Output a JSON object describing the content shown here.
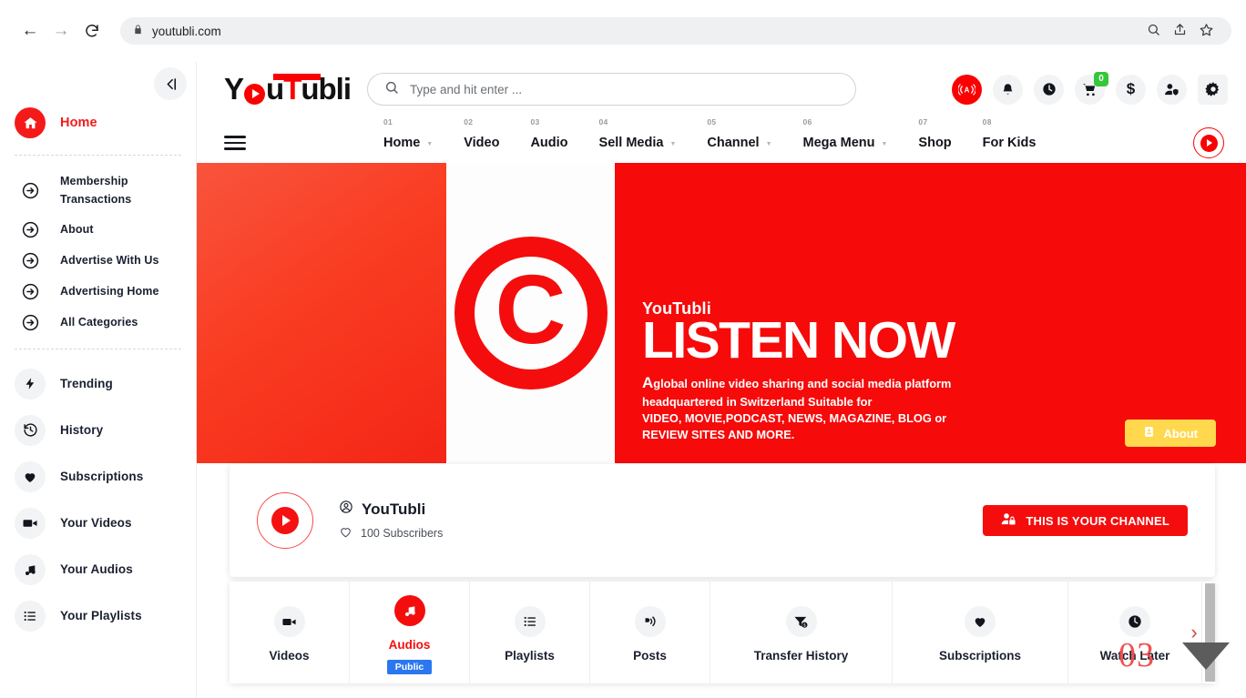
{
  "browser": {
    "back_icon": "back-arrow-icon",
    "forward_icon": "forward-arrow-icon",
    "reload_icon": "reload-icon",
    "lock_icon": "lock-icon",
    "url": "youtubli.com",
    "zoom_icon": "search-zoom-icon",
    "share_icon": "share-icon",
    "bookmark_icon": "star-icon"
  },
  "sidebar": {
    "collapse_label": "collapse-sidebar",
    "home": {
      "label": "Home",
      "icon": "home-icon"
    },
    "links": [
      {
        "label": "Membership Transactions",
        "icon": "arrow-circle-icon"
      },
      {
        "label": "About",
        "icon": "arrow-circle-icon"
      },
      {
        "label": "Advertise With Us",
        "icon": "arrow-circle-icon"
      },
      {
        "label": "Advertising Home",
        "icon": "arrow-circle-icon"
      },
      {
        "label": "All Categories",
        "icon": "arrow-circle-icon"
      }
    ],
    "items": [
      {
        "label": "Trending",
        "icon": "bolt-icon"
      },
      {
        "label": "History",
        "icon": "history-icon"
      },
      {
        "label": "Subscriptions",
        "icon": "heart-icon"
      },
      {
        "label": "Your Videos",
        "icon": "video-camera-icon"
      },
      {
        "label": "Your Audios",
        "icon": "music-note-icon"
      },
      {
        "label": "Your Playlists",
        "icon": "list-icon"
      }
    ]
  },
  "header": {
    "logo": {
      "part1": "Y",
      "part2": "o",
      "part3": "u",
      "part4": "T",
      "part5": "ubli"
    },
    "search": {
      "placeholder": "Type and hit enter ...",
      "value": "",
      "icon": "search-icon"
    },
    "icons": [
      {
        "name": "live-broadcast-icon",
        "glyph": "((A))",
        "badge": ""
      },
      {
        "name": "bell-icon",
        "glyph": "",
        "badge": ""
      },
      {
        "name": "clock-icon",
        "glyph": "",
        "badge": ""
      },
      {
        "name": "cart-icon",
        "glyph": "",
        "badge": "0"
      },
      {
        "name": "dollar-icon",
        "glyph": "$",
        "badge": ""
      },
      {
        "name": "user-shield-icon",
        "glyph": "",
        "badge": ""
      },
      {
        "name": "gear-icon",
        "glyph": "",
        "badge": ""
      }
    ]
  },
  "nav": {
    "menu_icon": "hamburger-icon",
    "play_icon": "play-circle-icon",
    "items": [
      {
        "num": "01",
        "label": "Home",
        "caret": true
      },
      {
        "num": "02",
        "label": "Video",
        "caret": false
      },
      {
        "num": "03",
        "label": "Audio",
        "caret": false
      },
      {
        "num": "04",
        "label": "Sell Media",
        "caret": true
      },
      {
        "num": "05",
        "label": "Channel",
        "caret": true
      },
      {
        "num": "06",
        "label": "Mega Menu",
        "caret": true
      },
      {
        "num": "07",
        "label": "Shop",
        "caret": false
      },
      {
        "num": "08",
        "label": "For Kids",
        "caret": false
      }
    ]
  },
  "hero": {
    "copyright_symbol": "copyright-icon",
    "kicker": "YouTubli",
    "title": "LISTEN NOW",
    "desc_cap": "A",
    "desc_line1": "global online video sharing and social media platform",
    "desc_line2": "headquartered in Switzerland Suitable for",
    "desc_line3": "VIDEO, MOVIE,PODCAST, NEWS, MAGAZINE, BLOG or",
    "desc_line4": "REVIEW SITES AND MORE.",
    "about_button": "About",
    "about_icon": "id-card-icon"
  },
  "channel": {
    "avatar_icon": "play-circle-icon",
    "name_icon": "user-circle-icon",
    "name": "YouTubli",
    "subs_icon": "heart-outline-icon",
    "subscribers": "100 Subscribers",
    "cta_icon": "user-lock-icon",
    "cta_label": "THIS IS YOUR CHANNEL"
  },
  "tabs": {
    "scroll_right_icon": "chevron-right-icon",
    "items": [
      {
        "label": "Videos",
        "icon": "video-camera-icon",
        "active": false,
        "badge": ""
      },
      {
        "label": "Audios",
        "icon": "music-note-icon",
        "active": true,
        "badge": "Public"
      },
      {
        "label": "Playlists",
        "icon": "list-icon",
        "active": false,
        "badge": ""
      },
      {
        "label": "Posts",
        "icon": "broadcast-icon",
        "active": false,
        "badge": ""
      },
      {
        "label": "Transfer History",
        "icon": "funnel-dollar-icon",
        "active": false,
        "badge": ""
      },
      {
        "label": "Subscriptions",
        "icon": "heart-icon",
        "active": false,
        "badge": ""
      },
      {
        "label": "Watch Later",
        "icon": "clock-icon",
        "active": false,
        "badge": ""
      }
    ]
  },
  "footer": {
    "page_number": "03",
    "scroll_down_icon": "triangle-down-icon"
  },
  "colors": {
    "brand_red": "#f50d0d",
    "accent_yellow": "#ffd84d",
    "badge_blue": "#2b77f0",
    "badge_green": "#35c63c"
  }
}
